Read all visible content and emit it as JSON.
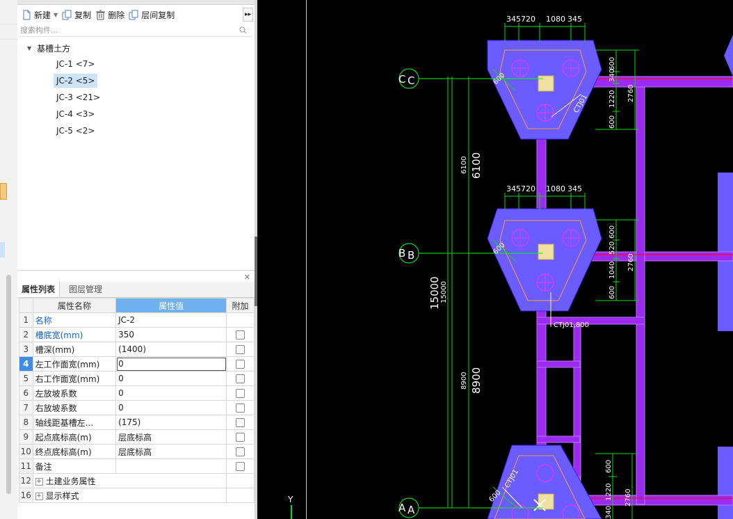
{
  "toolbar": {
    "new_label": "新建",
    "copy_label": "复制",
    "delete_label": "删除",
    "floor_copy_label": "层间复制",
    "more_glyph": "▸▸"
  },
  "search": {
    "placeholder": "搜索构件..."
  },
  "tree": {
    "root_label": "基槽土方",
    "items": [
      {
        "label": "JC-1 <7>",
        "selected": false
      },
      {
        "label": "JC-2 <5>",
        "selected": true
      },
      {
        "label": "JC-3 <21>",
        "selected": false
      },
      {
        "label": "JC-4 <3>",
        "selected": false
      },
      {
        "label": "JC-5 <2>",
        "selected": false
      }
    ]
  },
  "prop_tabs": {
    "active": "属性列表",
    "inactive": "图层管理"
  },
  "prop_table": {
    "headers": {
      "name": "属性名称",
      "value": "属性值",
      "extra": "附加"
    },
    "rows": [
      {
        "num": "1",
        "name": "名称",
        "value": "JC-2",
        "blue": true,
        "checkbox": false
      },
      {
        "num": "2",
        "name": "槽底宽(mm)",
        "value": "350",
        "blue": true,
        "checkbox": true
      },
      {
        "num": "3",
        "name": "槽深(mm)",
        "value": "(1400)",
        "blue": false,
        "checkbox": true
      },
      {
        "num": "4",
        "name": "左工作面宽(mm)",
        "value": "0",
        "blue": false,
        "checkbox": true,
        "active": true
      },
      {
        "num": "5",
        "name": "右工作面宽(mm)",
        "value": "0",
        "blue": false,
        "checkbox": true
      },
      {
        "num": "6",
        "name": "左放坡系数",
        "value": "0",
        "blue": false,
        "checkbox": true
      },
      {
        "num": "7",
        "name": "右放坡系数",
        "value": "0",
        "blue": false,
        "checkbox": true
      },
      {
        "num": "8",
        "name": "轴线距基槽左...",
        "value": "(175)",
        "blue": false,
        "checkbox": true
      },
      {
        "num": "9",
        "name": "起点底标高(m)",
        "value": "层底标高",
        "blue": false,
        "checkbox": true
      },
      {
        "num": "10",
        "name": "终点底标高(m)",
        "value": "层底标高",
        "blue": false,
        "checkbox": true
      },
      {
        "num": "11",
        "name": "备注",
        "value": "",
        "blue": false,
        "checkbox": true
      },
      {
        "num": "12",
        "name": "土建业务属性",
        "value": "",
        "group": true
      },
      {
        "num": "16",
        "name": "显示样式",
        "value": "",
        "group": true
      }
    ]
  },
  "cad": {
    "axes": [
      "C",
      "B",
      "A"
    ],
    "top_dims": [
      "345",
      "720",
      "1080",
      "345"
    ],
    "mid_dims": [
      "345",
      "720",
      "1080",
      "345"
    ],
    "right_dims_c": [
      "600",
      "340",
      "1220",
      "600"
    ],
    "right_total_c": "2760",
    "right_dims_b": [
      "600",
      "520",
      "1040",
      "600"
    ],
    "right_total_b": "2760",
    "right_dims_a": [
      "600",
      "1220",
      "340"
    ],
    "right_total_a": "2760",
    "span_small": [
      "6100",
      "8900",
      "15000"
    ],
    "span_large": [
      "6100",
      "8900",
      "15000"
    ],
    "corner_dim": "600",
    "labels": [
      "CTJ01",
      "CTJ01,800",
      "CTJ01"
    ],
    "y_axis": "Y",
    "colors": {
      "bg": "#000000",
      "pile_cap": "#6a5cff",
      "beam": "#9b2bf0",
      "dim": "#00e000",
      "axis": "#ff0000"
    }
  }
}
